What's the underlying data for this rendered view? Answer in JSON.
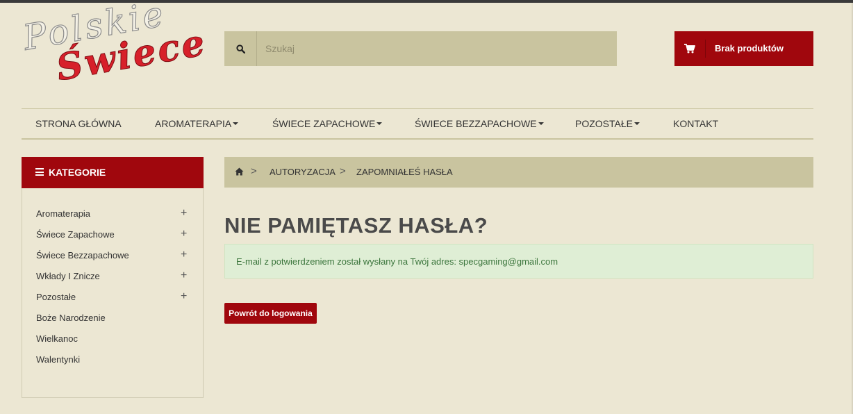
{
  "logo": {
    "line1": "Polskie",
    "line2": "Świece"
  },
  "search": {
    "placeholder": "Szukaj",
    "icon": "search-icon"
  },
  "cart": {
    "label": "Brak produktów",
    "icon": "cart-icon"
  },
  "nav": {
    "items": [
      {
        "label": "STRONA GŁÓWNA",
        "dropdown": false
      },
      {
        "label": "AROMATERAPIA",
        "dropdown": true
      },
      {
        "label": "ŚWIECE ZAPACHOWE",
        "dropdown": true
      },
      {
        "label": "ŚWIECE BEZZAPACHOWE",
        "dropdown": true
      },
      {
        "label": "POZOSTAŁE",
        "dropdown": true
      },
      {
        "label": "KONTAKT",
        "dropdown": false
      }
    ]
  },
  "sidebar": {
    "title": "KATEGORIE",
    "items": [
      {
        "label": "Aromaterapia",
        "expandable": true
      },
      {
        "label": "Świece Zapachowe",
        "expandable": true
      },
      {
        "label": "Świece Bezzapachowe",
        "expandable": true
      },
      {
        "label": "Wkłady I Znicze",
        "expandable": true
      },
      {
        "label": "Pozostałe",
        "expandable": true
      },
      {
        "label": "Boże Narodzenie",
        "expandable": false
      },
      {
        "label": "Wielkanoc",
        "expandable": false
      },
      {
        "label": "Walentynki",
        "expandable": false
      }
    ],
    "expand_symbol": "+"
  },
  "breadcrumb": {
    "separator": ">",
    "items": [
      "AUTORYZACJA",
      "ZAPOMNIAŁEŚ HASŁA"
    ]
  },
  "main": {
    "title": "NIE PAMIĘTASZ HASŁA?",
    "alert": "E-mail z potwierdzeniem został wysłany na Twój adres: specgaming@gmail.com",
    "back_button": "Powrót do logowania"
  },
  "colors": {
    "background": "#ece7d3",
    "accent_red": "#a0070d",
    "khaki": "#c9c49f",
    "alert_bg": "#dfeed5",
    "alert_text": "#3c763d"
  }
}
